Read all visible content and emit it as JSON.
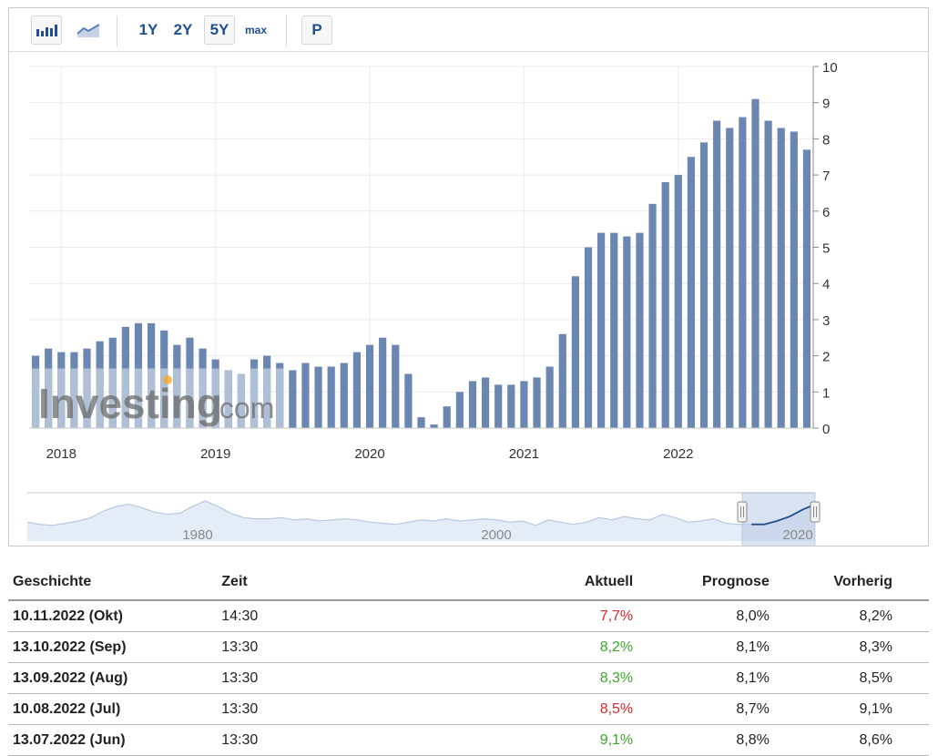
{
  "toolbar": {
    "range_buttons": [
      "1Y",
      "2Y",
      "5Y",
      "max"
    ],
    "selected_range": "5Y",
    "p_label": "P",
    "icons": [
      "bar-chart-icon",
      "line-chart-icon"
    ]
  },
  "watermark": {
    "text_main": "Investing",
    "text_suffix": ".com"
  },
  "colors": {
    "bar": "#6b86b0",
    "bar_light": "#aebfd6",
    "positive": "#3ea52d",
    "negative": "#e0262a",
    "navigator_line": "#1f4f8f"
  },
  "chart_data": {
    "type": "bar",
    "x": [
      "2017-11",
      "2017-12",
      "2018-01",
      "2018-02",
      "2018-03",
      "2018-04",
      "2018-05",
      "2018-06",
      "2018-07",
      "2018-08",
      "2018-09",
      "2018-10",
      "2018-11",
      "2018-12",
      "2019-01",
      "2019-02",
      "2019-03",
      "2019-04",
      "2019-05",
      "2019-06",
      "2019-07",
      "2019-08",
      "2019-09",
      "2019-10",
      "2019-11",
      "2019-12",
      "2020-01",
      "2020-02",
      "2020-03",
      "2020-04",
      "2020-05",
      "2020-06",
      "2020-07",
      "2020-08",
      "2020-09",
      "2020-10",
      "2020-11",
      "2020-12",
      "2021-01",
      "2021-02",
      "2021-03",
      "2021-04",
      "2021-05",
      "2021-06",
      "2021-07",
      "2021-08",
      "2021-09",
      "2021-10",
      "2021-11",
      "2021-12",
      "2022-01",
      "2022-02",
      "2022-03",
      "2022-04",
      "2022-05",
      "2022-06",
      "2022-07",
      "2022-08",
      "2022-09",
      "2022-10"
    ],
    "values": [
      2.0,
      2.2,
      2.1,
      2.1,
      2.2,
      2.4,
      2.5,
      2.8,
      2.9,
      2.9,
      2.7,
      2.3,
      2.5,
      2.2,
      1.9,
      1.6,
      1.5,
      1.9,
      2.0,
      1.8,
      1.6,
      1.8,
      1.7,
      1.7,
      1.8,
      2.1,
      2.3,
      2.5,
      2.3,
      1.5,
      0.3,
      0.1,
      0.6,
      1.0,
      1.3,
      1.4,
      1.2,
      1.2,
      1.3,
      1.4,
      1.7,
      2.6,
      4.2,
      5.0,
      5.4,
      5.4,
      5.3,
      5.4,
      6.2,
      6.8,
      7.0,
      7.5,
      7.9,
      8.5,
      8.3,
      8.6,
      9.1,
      8.5,
      8.3,
      8.2,
      7.7
    ],
    "x_ticks": [
      "2018",
      "2019",
      "2020",
      "2021",
      "2022"
    ],
    "y_ticks": [
      "10",
      "9",
      "8",
      "7",
      "6",
      "5",
      "4",
      "3",
      "2",
      "1",
      "0"
    ],
    "ylim": [
      0,
      10
    ],
    "grid": true,
    "y_axis_side": "right",
    "navigator": {
      "tick_labels": [
        "1980",
        "2000",
        "2020"
      ],
      "series": [
        1.2,
        1.0,
        0.9,
        1.1,
        1.3,
        1.6,
        2.2,
        2.6,
        2.8,
        2.5,
        2.1,
        1.9,
        2.0,
        2.6,
        3.1,
        2.6,
        2.0,
        1.6,
        1.5,
        1.5,
        1.6,
        1.4,
        1.5,
        1.3,
        1.4,
        1.5,
        1.4,
        1.2,
        1.1,
        1.0,
        1.2,
        1.4,
        1.3,
        1.5,
        1.3,
        1.4,
        1.5,
        1.4,
        1.2,
        1.3,
        0.9,
        1.4,
        1.2,
        1.0,
        1.2,
        1.6,
        1.4,
        1.7,
        1.5,
        1.4,
        1.9,
        1.6,
        1.2,
        1.3,
        1.5,
        1.1,
        1.0,
        1.0,
        1.0,
        1.3,
        1.7,
        2.3,
        2.8
      ]
    }
  },
  "table": {
    "headers": {
      "geschichte": "Geschichte",
      "zeit": "Zeit",
      "aktuell": "Aktuell",
      "prognose": "Prognose",
      "vorherig": "Vorherig"
    },
    "rows": [
      {
        "date": "10.11.2022 (Okt)",
        "time": "14:30",
        "actual": "7,7%",
        "forecast": "8,0%",
        "previous": "8,2%",
        "status": "negative"
      },
      {
        "date": "13.10.2022 (Sep)",
        "time": "13:30",
        "actual": "8,2%",
        "forecast": "8,1%",
        "previous": "8,3%",
        "status": "positive"
      },
      {
        "date": "13.09.2022 (Aug)",
        "time": "13:30",
        "actual": "8,3%",
        "forecast": "8,1%",
        "previous": "8,5%",
        "status": "positive"
      },
      {
        "date": "10.08.2022 (Jul)",
        "time": "13:30",
        "actual": "8,5%",
        "forecast": "8,7%",
        "previous": "9,1%",
        "status": "negative"
      },
      {
        "date": "13.07.2022 (Jun)",
        "time": "13:30",
        "actual": "9,1%",
        "forecast": "8,8%",
        "previous": "8,6%",
        "status": "positive"
      }
    ]
  }
}
